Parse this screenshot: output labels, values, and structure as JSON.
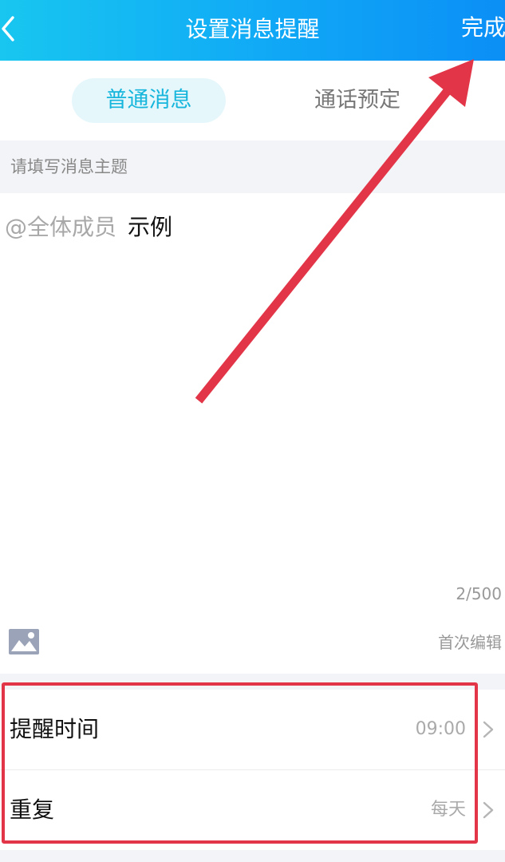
{
  "header": {
    "title": "设置消息提醒",
    "done_label": "完成",
    "back_icon": "chevron-left-icon",
    "gradient_colors": [
      "#18c6f0",
      "#0b8ff6"
    ]
  },
  "tabs": [
    {
      "label": "普通消息",
      "active": true
    },
    {
      "label": "通话预定",
      "active": false
    }
  ],
  "message_section": {
    "label": "请填写消息主题",
    "mention": "@全体成员",
    "text": "示例",
    "char_count": "2/500",
    "image_icon": "image-icon",
    "edit_status": "首次编辑"
  },
  "settings": [
    {
      "label": "提醒时间",
      "value": "09:00",
      "icon": "chevron-right-icon"
    },
    {
      "label": "重复",
      "value": "每天",
      "icon": "chevron-right-icon"
    }
  ],
  "annotation": {
    "color": "#e23648",
    "arrow_target": "done-button",
    "highlight_target": "reminder-settings"
  }
}
